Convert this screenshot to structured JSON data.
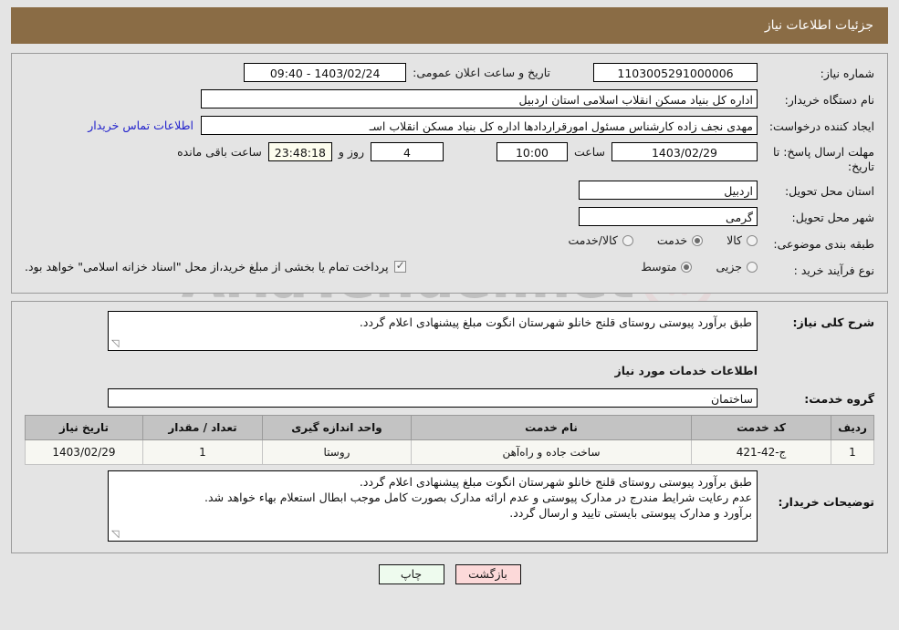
{
  "header": {
    "title": "جزئیات اطلاعات نیاز",
    "bg_color": "#8a6c45",
    "text_color": "#ffffff"
  },
  "watermark": {
    "text": "AriaTender.net",
    "shield_color": "#9a9a9a",
    "accent_color": "#e8b8bd"
  },
  "form": {
    "need_number_label": "شماره نیاز:",
    "need_number_value": "1103005291000006",
    "announce_label": "تاریخ و ساعت اعلان عمومی:",
    "announce_value": "1403/02/24 - 09:40",
    "buyer_org_label": "نام دستگاه خریدار:",
    "buyer_org_value": "اداره کل بنیاد مسکن انقلاب اسلامی استان اردبیل",
    "creator_label": "ایجاد کننده درخواست:",
    "creator_value": "مهدی نجف زاده کارشناس مسئول امورقراردادها اداره کل بنیاد مسکن انقلاب اسـ",
    "contact_link": "اطلاعات تماس خریدار",
    "deadline_label_line1": "مهلت ارسال پاسخ: تا",
    "deadline_label_line2": "تاریخ:",
    "deadline_date": "1403/02/29",
    "deadline_time_label": "ساعت",
    "deadline_time": "10:00",
    "remaining_days": "4",
    "remaining_days_label": "روز و",
    "remaining_clock": "23:48:18",
    "remaining_suffix": "ساعت باقی مانده",
    "province_label": "استان محل تحویل:",
    "province_value": "اردبیل",
    "city_label": "شهر محل تحویل:",
    "city_value": "گرمی",
    "category_label": "طبقه بندی موضوعی:",
    "category_options": [
      {
        "label": "کالا",
        "selected": false
      },
      {
        "label": "خدمت",
        "selected": true
      },
      {
        "label": "کالا/خدمت",
        "selected": false
      }
    ],
    "process_label": "نوع فرآیند خرید :",
    "process_options": [
      {
        "label": "جزیی",
        "selected": false
      },
      {
        "label": "متوسط",
        "selected": true
      }
    ],
    "treasury_checkbox_checked": true,
    "treasury_note": "پرداخت تمام یا بخشی از مبلغ خرید،از محل \"اسناد خزانه اسلامی\" خواهد بود."
  },
  "description": {
    "label": "شرح کلی نیاز:",
    "text": "طبق برآورد پیوستی روستای قلنج خانلو شهرستان انگوت مبلغ پیشنهادی اعلام گردد."
  },
  "services": {
    "section_title": "اطلاعات خدمات مورد نیاز",
    "group_label": "گروه خدمت:",
    "group_value": "ساختمان",
    "table": {
      "columns": [
        "ردیف",
        "کد خدمت",
        "نام خدمت",
        "واحد اندازه گیری",
        "تعداد / مقدار",
        "تاریخ نیاز"
      ],
      "rows": [
        {
          "row_no": "1",
          "service_code": "ج-42-421",
          "service_name": "ساخت جاده و راه‌آهن",
          "unit": "روستا",
          "quantity": "1",
          "need_date": "1403/02/29"
        }
      ]
    }
  },
  "buyer_notes": {
    "label": "توضیحات خریدار:",
    "lines": [
      "طبق برآورد پیوستی روستای قلنج خانلو شهرستان انگوت مبلغ پیشنهادی اعلام گردد.",
      "عدم رعایت شرایط مندرج در مدارک پیوستی و عدم ارائه مدارک بصورت کامل موجب ابطال استعلام بهاء خواهد شد.",
      "برآورد و مدارک پیوستی بایستی تایید و ارسال گردد."
    ]
  },
  "buttons": {
    "print": "چاپ",
    "back": "بازگشت"
  }
}
